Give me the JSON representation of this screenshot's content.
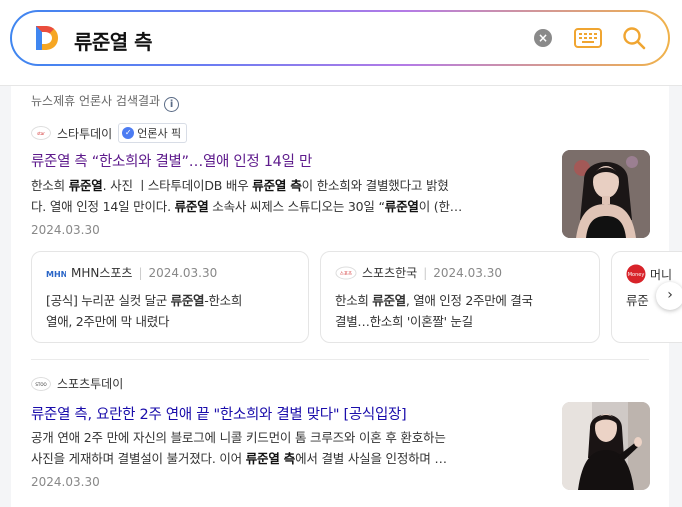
{
  "search": {
    "query": "류준열 측"
  },
  "section": {
    "title": "뉴스제휴 언론사 검색결과"
  },
  "results": [
    {
      "press": "스타투데이",
      "badge": "언론사 픽",
      "headline_a": "류준열 측",
      "headline_b": " “한소희와 결별”…열애 인정 14일 만",
      "snippet_line1": [
        "한소희 ",
        "류준열",
        ". 사진 ㅣ스타투데이DB 배우 ",
        "류준열 측",
        "이 한소희와 결별했다고 밝혔"
      ],
      "snippet_line2": [
        "다. 열애 인정 14일 만이다. ",
        "류준열",
        " 소속사 씨제스 스튜디오는 30일 “",
        "류준열",
        "이 (한…"
      ],
      "date": "2024.03.30"
    },
    {
      "press": "스포츠투데이",
      "headline_a": "류준열 측",
      "headline_b": ", 요란한 2주 연애 끝 \"한소희와 결별 맞다\" [공식입장]",
      "snippet_line1": [
        "공개 연애 2주 만에 자신의 블로그에 니콜 키드먼이 톰 크루즈와 이혼 후 환호하는"
      ],
      "snippet_line2": [
        "사진을 게재하며 결별설이 불거졌다. 이어 ",
        "류준열 측",
        "에서 결별 사실을 인정하며 …"
      ],
      "date": "2024.03.30"
    }
  ],
  "related_cards": [
    {
      "press": "MHN스포츠",
      "date": "2024.03.30",
      "line1": [
        "[공식] 누리꾼 실컷 달군 ",
        "류준열",
        "-한소희"
      ],
      "line2": [
        "열애, 2주만에 막 내렸다"
      ]
    },
    {
      "press": "스포츠한국",
      "date": "2024.03.30",
      "line1": [
        "한소희 ",
        "류준열",
        ", 열애 인정 2주만에 결국"
      ],
      "line2": [
        "결별…한소희 '이혼짤' 눈길"
      ]
    },
    {
      "press": "머니",
      "line1": [
        "류준"
      ]
    }
  ],
  "colors": {
    "link": "#1a0dab",
    "visited": "#5e1b8c",
    "accent": "#f0b24a"
  },
  "icons": [
    "daum-logo",
    "clear-icon",
    "keyboard-icon",
    "search-icon",
    "info-icon",
    "chevron-right-icon"
  ]
}
